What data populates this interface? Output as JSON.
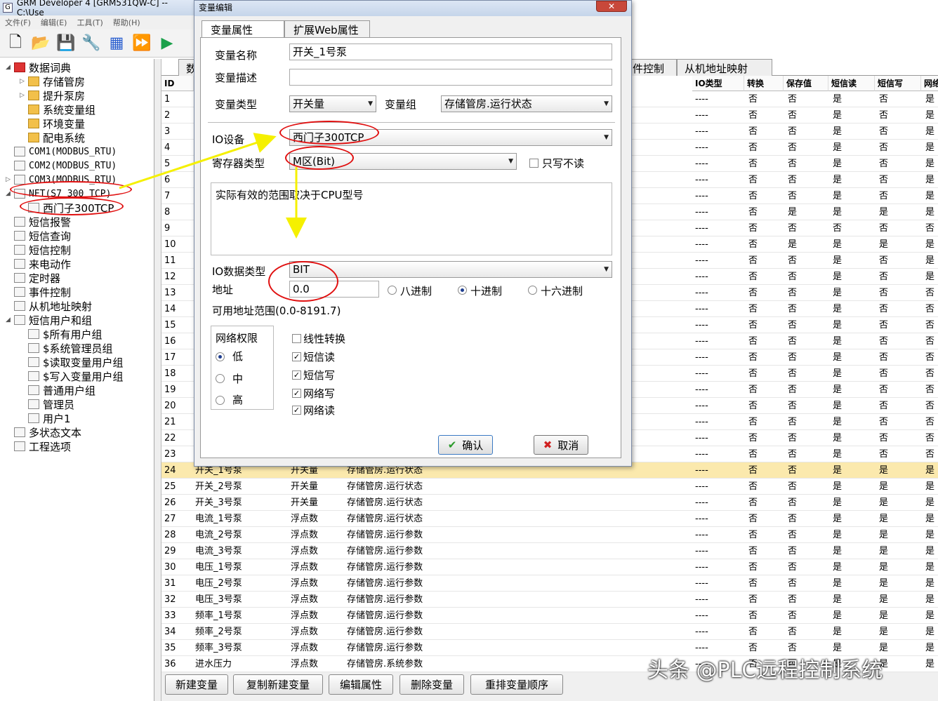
{
  "window": {
    "title": "GRM Developer 4 [GRM531QW-C]  -- C:\\Use"
  },
  "menu": [
    "文件(F)",
    "编辑(E)",
    "工具(T)",
    "帮助(H)"
  ],
  "tree": {
    "items": [
      {
        "label": "数据词典",
        "level": 0,
        "exp": "◢"
      },
      {
        "label": "存储管房",
        "level": 1,
        "exp": "▷"
      },
      {
        "label": "提升泵房",
        "level": 1,
        "exp": "▷"
      },
      {
        "label": "系统变量组",
        "level": 1,
        "exp": ""
      },
      {
        "label": "环境变量",
        "level": 1,
        "exp": ""
      },
      {
        "label": "配电系统",
        "level": 1,
        "exp": ""
      },
      {
        "label": "COM1(MODBUS_RTU)",
        "level": 0,
        "exp": ""
      },
      {
        "label": "COM2(MODBUS_RTU)",
        "level": 0,
        "exp": ""
      },
      {
        "label": "COM3(MODBUS_RTU)",
        "level": 0,
        "exp": "▷"
      },
      {
        "label": "NET(S7_300_TCP)",
        "level": 0,
        "exp": "◢"
      },
      {
        "label": "西门子300TCP",
        "level": 1,
        "exp": ""
      },
      {
        "label": "短信报警",
        "level": 0,
        "exp": ""
      },
      {
        "label": "短信查询",
        "level": 0,
        "exp": ""
      },
      {
        "label": "短信控制",
        "level": 0,
        "exp": ""
      },
      {
        "label": "来电动作",
        "level": 0,
        "exp": ""
      },
      {
        "label": "定时器",
        "level": 0,
        "exp": ""
      },
      {
        "label": "事件控制",
        "level": 0,
        "exp": ""
      },
      {
        "label": "从机地址映射",
        "level": 0,
        "exp": ""
      },
      {
        "label": "短信用户和组",
        "level": 0,
        "exp": "◢"
      },
      {
        "label": "$所有用户组",
        "level": 1,
        "exp": ""
      },
      {
        "label": "$系统管理员组",
        "level": 1,
        "exp": ""
      },
      {
        "label": "$读取变量用户组",
        "level": 1,
        "exp": ""
      },
      {
        "label": "$写入变量用户组",
        "level": 1,
        "exp": ""
      },
      {
        "label": "普通用户组",
        "level": 1,
        "exp": ""
      },
      {
        "label": "管理员",
        "level": 1,
        "exp": ""
      },
      {
        "label": "用户1",
        "level": 1,
        "exp": ""
      },
      {
        "label": "多状态文本",
        "level": 0,
        "exp": ""
      },
      {
        "label": "工程选项",
        "level": 0,
        "exp": ""
      }
    ]
  },
  "tabs": [
    "数",
    "件控制",
    "从机地址映射"
  ],
  "grid": {
    "headers": [
      "ID",
      "IO类型",
      "转换",
      "保存值",
      "短信读",
      "短信写",
      "网络"
    ],
    "top_rows": [
      [
        "1",
        "----",
        "否",
        "否",
        "是",
        "否",
        "是"
      ],
      [
        "2",
        "----",
        "否",
        "否",
        "是",
        "否",
        "是"
      ],
      [
        "3",
        "----",
        "否",
        "否",
        "是",
        "否",
        "是"
      ],
      [
        "4",
        "----",
        "否",
        "否",
        "是",
        "否",
        "是"
      ],
      [
        "5",
        "----",
        "否",
        "否",
        "是",
        "否",
        "是"
      ],
      [
        "6",
        "----",
        "否",
        "否",
        "是",
        "否",
        "是"
      ],
      [
        "7",
        "----",
        "否",
        "否",
        "是",
        "否",
        "是"
      ],
      [
        "8",
        "----",
        "否",
        "是",
        "是",
        "是",
        "是"
      ],
      [
        "9",
        "----",
        "否",
        "否",
        "否",
        "否",
        "否"
      ],
      [
        "10",
        "----",
        "否",
        "是",
        "是",
        "是",
        "是"
      ],
      [
        "11",
        "----",
        "否",
        "否",
        "是",
        "否",
        "是"
      ],
      [
        "12",
        "----",
        "否",
        "否",
        "是",
        "否",
        "是"
      ],
      [
        "13",
        "----",
        "否",
        "否",
        "是",
        "否",
        "否"
      ],
      [
        "14",
        "----",
        "否",
        "否",
        "是",
        "否",
        "否"
      ],
      [
        "15",
        "----",
        "否",
        "否",
        "是",
        "否",
        "否"
      ],
      [
        "16",
        "----",
        "否",
        "否",
        "是",
        "否",
        "否"
      ],
      [
        "17",
        "----",
        "否",
        "否",
        "是",
        "否",
        "否"
      ],
      [
        "18",
        "----",
        "否",
        "否",
        "是",
        "否",
        "否"
      ],
      [
        "19",
        "----",
        "否",
        "否",
        "是",
        "否",
        "否"
      ],
      [
        "20",
        "----",
        "否",
        "否",
        "是",
        "否",
        "否"
      ],
      [
        "21",
        "----",
        "否",
        "否",
        "是",
        "否",
        "否"
      ],
      [
        "22",
        "----",
        "否",
        "否",
        "是",
        "否",
        "否"
      ],
      [
        "23",
        "----",
        "否",
        "否",
        "是",
        "否",
        "否"
      ]
    ],
    "bottom_rows": [
      [
        "24",
        "开关_1号泵",
        "开关量",
        "存储管房.运行状态",
        "----",
        "否",
        "否",
        "是",
        "是",
        "是"
      ],
      [
        "25",
        "开关_2号泵",
        "开关量",
        "存储管房.运行状态",
        "----",
        "否",
        "否",
        "是",
        "是",
        "是"
      ],
      [
        "26",
        "开关_3号泵",
        "开关量",
        "存储管房.运行状态",
        "----",
        "否",
        "否",
        "是",
        "是",
        "是"
      ],
      [
        "27",
        "电流_1号泵",
        "浮点数",
        "存储管房.运行状态",
        "----",
        "否",
        "否",
        "是",
        "是",
        "是"
      ],
      [
        "28",
        "电流_2号泵",
        "浮点数",
        "存储管房.运行参数",
        "----",
        "否",
        "否",
        "是",
        "是",
        "是"
      ],
      [
        "29",
        "电流_3号泵",
        "浮点数",
        "存储管房.运行参数",
        "----",
        "否",
        "否",
        "是",
        "是",
        "是"
      ],
      [
        "30",
        "电压_1号泵",
        "浮点数",
        "存储管房.运行参数",
        "----",
        "否",
        "否",
        "是",
        "是",
        "是"
      ],
      [
        "31",
        "电压_2号泵",
        "浮点数",
        "存储管房.运行参数",
        "----",
        "否",
        "否",
        "是",
        "是",
        "是"
      ],
      [
        "32",
        "电压_3号泵",
        "浮点数",
        "存储管房.运行参数",
        "----",
        "否",
        "否",
        "是",
        "是",
        "是"
      ],
      [
        "33",
        "频率_1号泵",
        "浮点数",
        "存储管房.运行参数",
        "----",
        "否",
        "否",
        "是",
        "是",
        "是"
      ],
      [
        "34",
        "频率_2号泵",
        "浮点数",
        "存储管房.运行参数",
        "----",
        "否",
        "否",
        "是",
        "是",
        "是"
      ],
      [
        "35",
        "频率_3号泵",
        "浮点数",
        "存储管房.运行参数",
        "----",
        "否",
        "否",
        "是",
        "是",
        "是"
      ],
      [
        "36",
        "进水压力",
        "浮点数",
        "存储管房.系统参数",
        "----",
        "否",
        "否",
        "是",
        "是",
        "是"
      ]
    ]
  },
  "bottom_buttons": [
    "新建变量",
    "复制新建变量",
    "编辑属性",
    "删除变量",
    "重排变量顺序"
  ],
  "dialog": {
    "title": "变量编辑",
    "close": "✕",
    "tabs": [
      "变量属性",
      "扩展Web属性"
    ],
    "name_label": "变量名称",
    "name_value": "开关_1号泵",
    "desc_label": "变量描述",
    "desc_value": "",
    "type_label": "变量类型",
    "type_value": "开关量",
    "group_label": "变量组",
    "group_value": "存储管房.运行状态",
    "io_device_label": "IO设备",
    "io_device_value": "西门子300TCP",
    "reg_type_label": "寄存器类型",
    "reg_type_value": "M区(Bit)",
    "write_only_label": "只写不读",
    "info_text": "实际有效的范围取决于CPU型号",
    "io_data_type_label": "IO数据类型",
    "io_data_type_value": "BIT",
    "addr_label": "地址",
    "addr_value": "0.0",
    "radix_oct": "八进制",
    "radix_dec": "十进制",
    "radix_hex": "十六进制",
    "range_text": "可用地址范围(0.0-8191.7)",
    "perm_title": "网络权限",
    "perm_low": "低",
    "perm_mid": "中",
    "perm_high": "高",
    "opt_linear": "线性转换",
    "opt_sms_read": "短信读",
    "opt_sms_write": "短信写",
    "opt_net_write": "网络写",
    "opt_net_read": "网络读",
    "ok": "确认",
    "cancel": "取消"
  },
  "watermark": "头条 @PLC远程控制系统",
  "colors": {
    "annotation": "#e01010",
    "arrow": "#f5f000",
    "selected_row": "#fbe9ad"
  }
}
